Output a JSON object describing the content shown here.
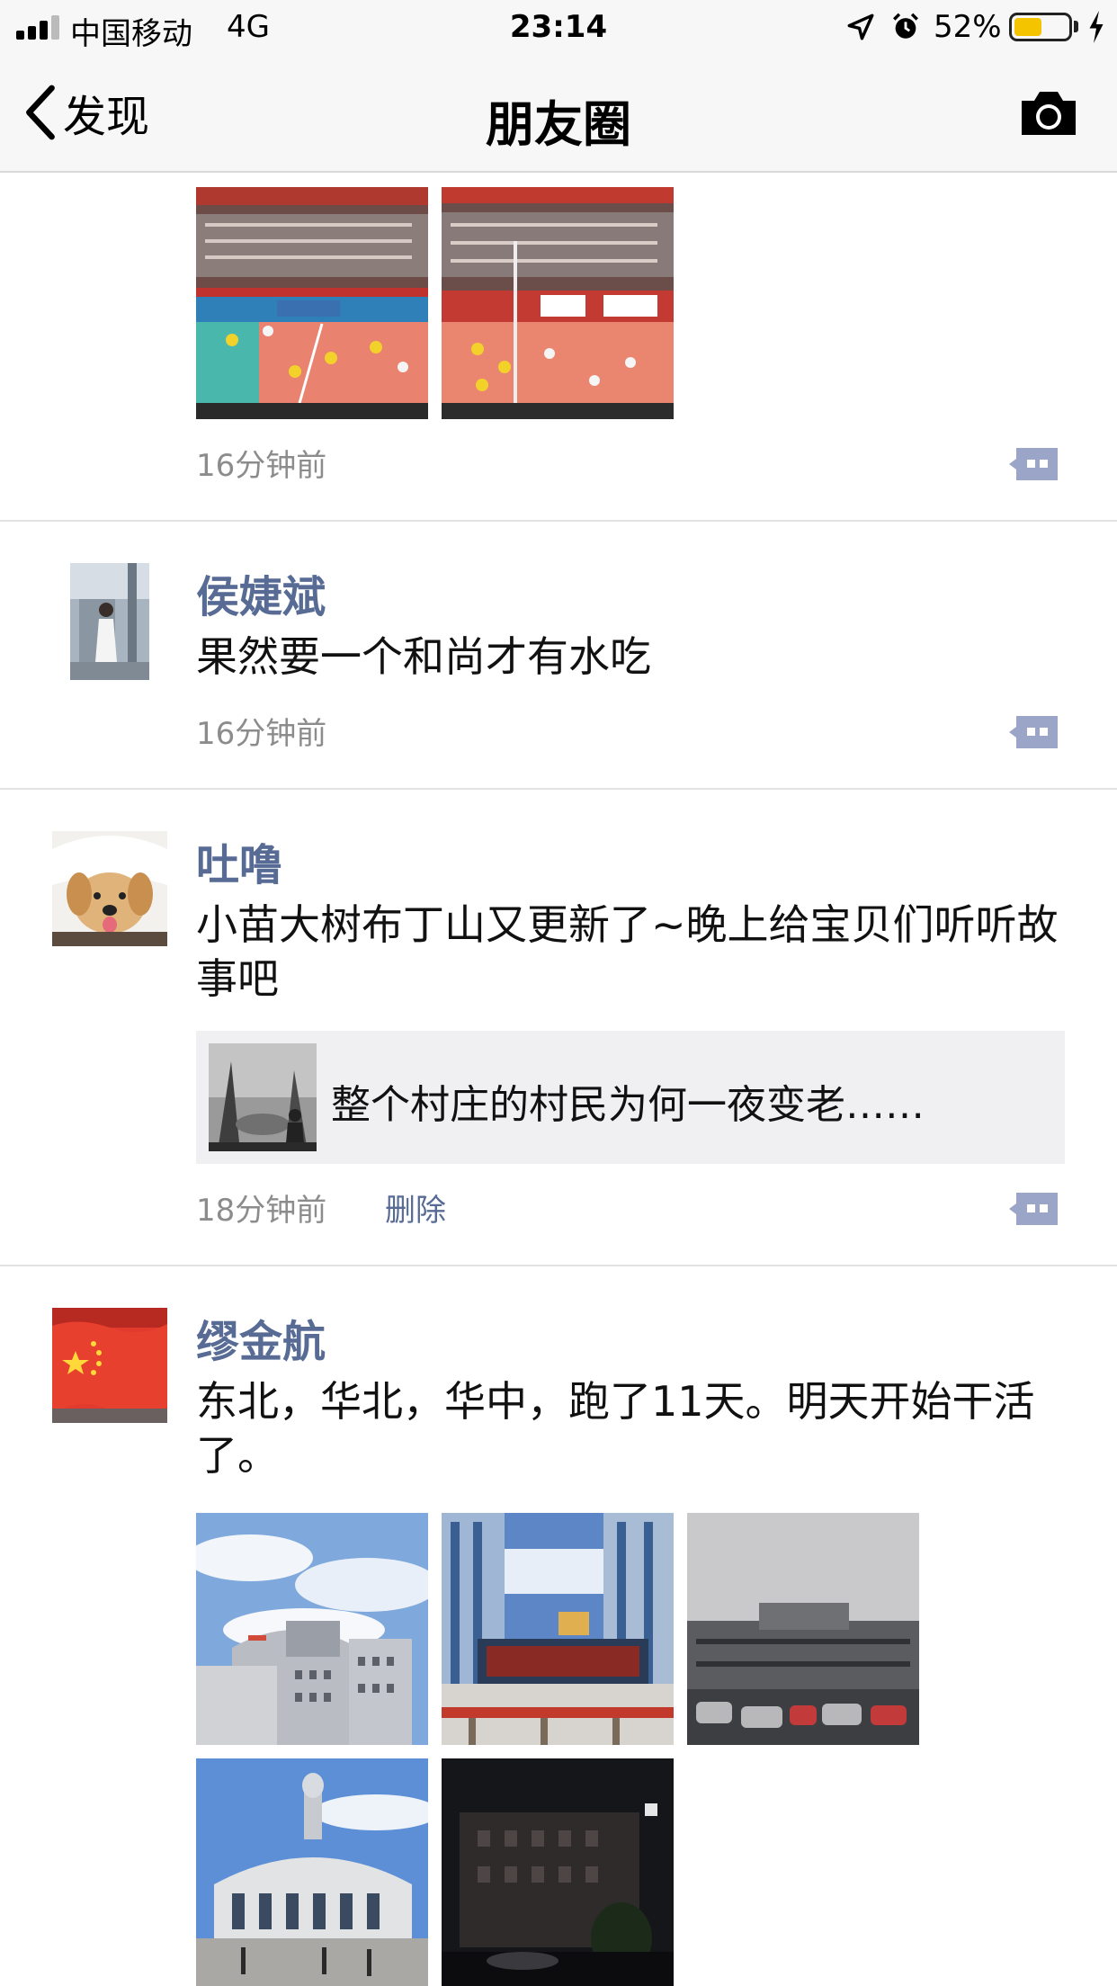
{
  "status_bar": {
    "carrier": "中国移动",
    "network": "4G",
    "time": "23:14",
    "battery_percent": "52%",
    "battery_level": 0.52,
    "battery_color": "#f5c400"
  },
  "nav": {
    "back_label": "发现",
    "title": "朋友圈",
    "camera_icon": "camera-icon"
  },
  "posts": [
    {
      "time": "16分钟前",
      "photos": [
        "volleyball-match-photo",
        "volleyball-match-photo"
      ]
    },
    {
      "username": "侯婕斌",
      "text": "果然要一个和尚才有水吃",
      "time": "16分钟前"
    },
    {
      "username": "吐噜",
      "text": "小苗大树布丁山又更新了~晚上给宝贝们听听故事吧",
      "link_title": "整个村庄的村民为何一夜变老……",
      "time": "18分钟前",
      "delete_label": "删除"
    },
    {
      "username": "缪金航",
      "text": "东北，华北，华中，跑了11天。明天开始干活了。",
      "photos": [
        "railway-station-photo",
        "railway-station-photo",
        "railway-station-photo",
        "railway-station-photo",
        "railway-station-photo"
      ]
    }
  ],
  "colors": {
    "username": "#576b95",
    "link_blue": "#576b95",
    "time_gray": "#8c8c8c",
    "comment_icon": "#9aa5c7"
  }
}
